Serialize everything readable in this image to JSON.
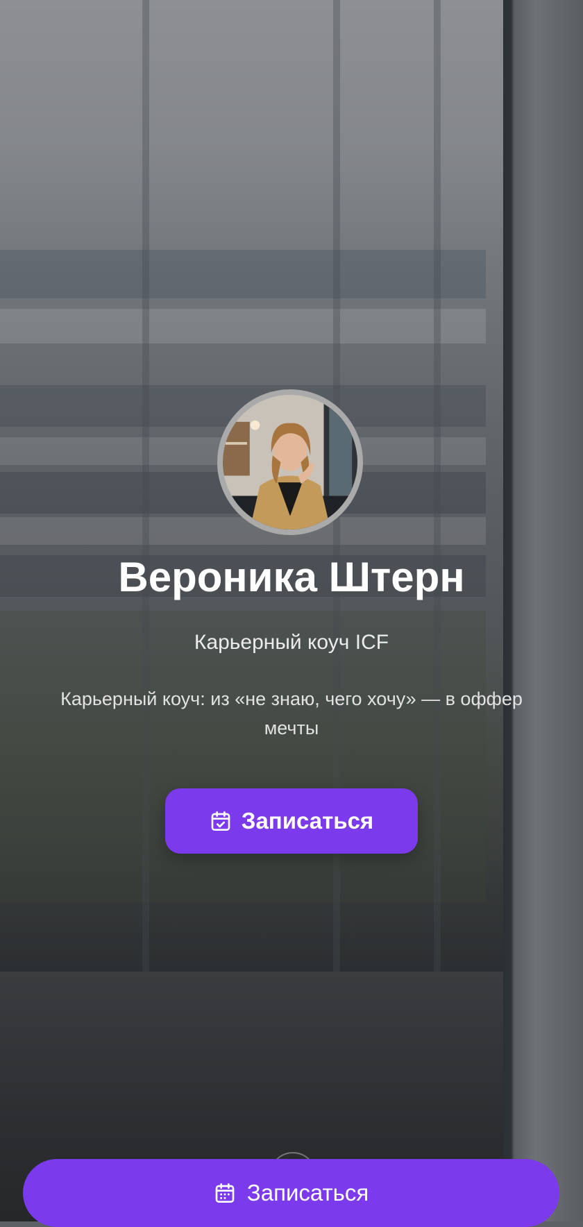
{
  "profile": {
    "name": "Вероника Штерн",
    "title": "Карьерный коуч ICF",
    "tagline": "Карьерный коуч: из «не знаю, чего хочу» — в оффер мечты"
  },
  "cta": {
    "label": "Записаться",
    "icon": "calendar-check-icon"
  },
  "sticky_cta": {
    "label": "Записаться",
    "icon": "calendar-icon"
  },
  "colors": {
    "accent": "#7c3aed",
    "text": "#ffffff",
    "avatar_ring": "#aaaaaa"
  }
}
